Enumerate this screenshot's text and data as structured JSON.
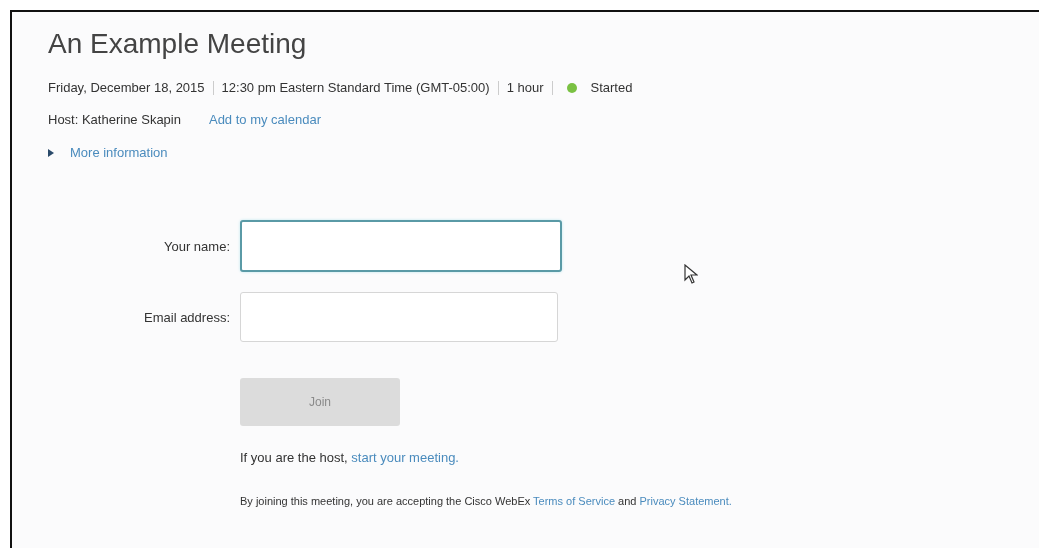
{
  "meeting": {
    "title": "An Example Meeting",
    "date": "Friday, December 18, 2015",
    "time": "12:30 pm Eastern Standard Time (GMT-05:00)",
    "duration": "1 hour",
    "status": {
      "label": "Started",
      "color": "#7ac143"
    },
    "host": "Host: Katherine Skapin",
    "calendar_link": "Add to my calendar"
  },
  "more_info": {
    "label": "More information",
    "expanded": false
  },
  "fields": [
    {
      "label": "Your name:",
      "focused": true
    },
    {
      "label": "Email address:",
      "focused": false
    }
  ],
  "join_button": {
    "label": "Join",
    "disabled": true
  },
  "host_note": {
    "text": "If you are the host,",
    "link": "start your meeting."
  },
  "terms": {
    "text": "By joining this meeting, you are accepting the Cisco WebEx",
    "link1": "Terms of Service",
    "and": "and",
    "link2": "Privacy Statement."
  }
}
